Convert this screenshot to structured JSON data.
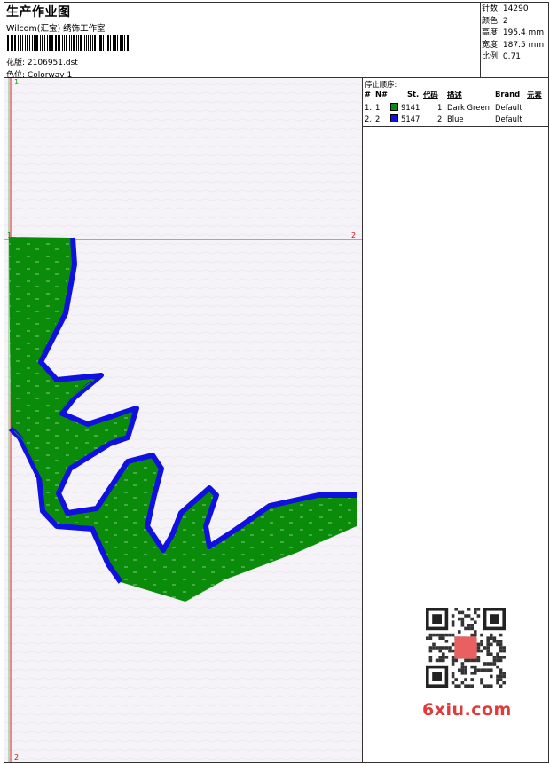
{
  "header": {
    "title": "生产作业图",
    "company": "Wilcom(汇宝) 绣饰工作室",
    "design_label": "花版:",
    "design_value": "2106951.dst",
    "colorway_label": "色位:",
    "colorway_value": "Colorway 1"
  },
  "stats": [
    {
      "label": "针数:",
      "value": "14290"
    },
    {
      "label": "颜色:",
      "value": "2"
    },
    {
      "label": "高度:",
      "value": "195.4 mm"
    },
    {
      "label": "宽度:",
      "value": "187.5 mm"
    },
    {
      "label": "比例:",
      "value": "0.71"
    }
  ],
  "stop_sequence": {
    "title": "停止顺序:",
    "headers": {
      "index": "#",
      "no": "N#",
      "stitches": "St.",
      "code": "代码",
      "description": "描述",
      "brand": "Brand",
      "element": "元素"
    },
    "rows": [
      {
        "index": "1.",
        "no": "1",
        "color": "#0a8c0a",
        "stitches": "9141",
        "code": "1",
        "description": "Dark Green",
        "brand": "Default"
      },
      {
        "index": "2.",
        "no": "2",
        "color": "#1010e0",
        "stitches": "5147",
        "code": "2",
        "description": "Blue",
        "brand": "Default"
      }
    ]
  },
  "markers": {
    "v_top": "1",
    "v_bottom": "2",
    "h_left": "1",
    "h_right": "2"
  },
  "colors": {
    "green": "#0a8c0a",
    "blue": "#1010e0",
    "guide": "#e02020"
  },
  "watermark": {
    "text": "6xiu.com"
  }
}
